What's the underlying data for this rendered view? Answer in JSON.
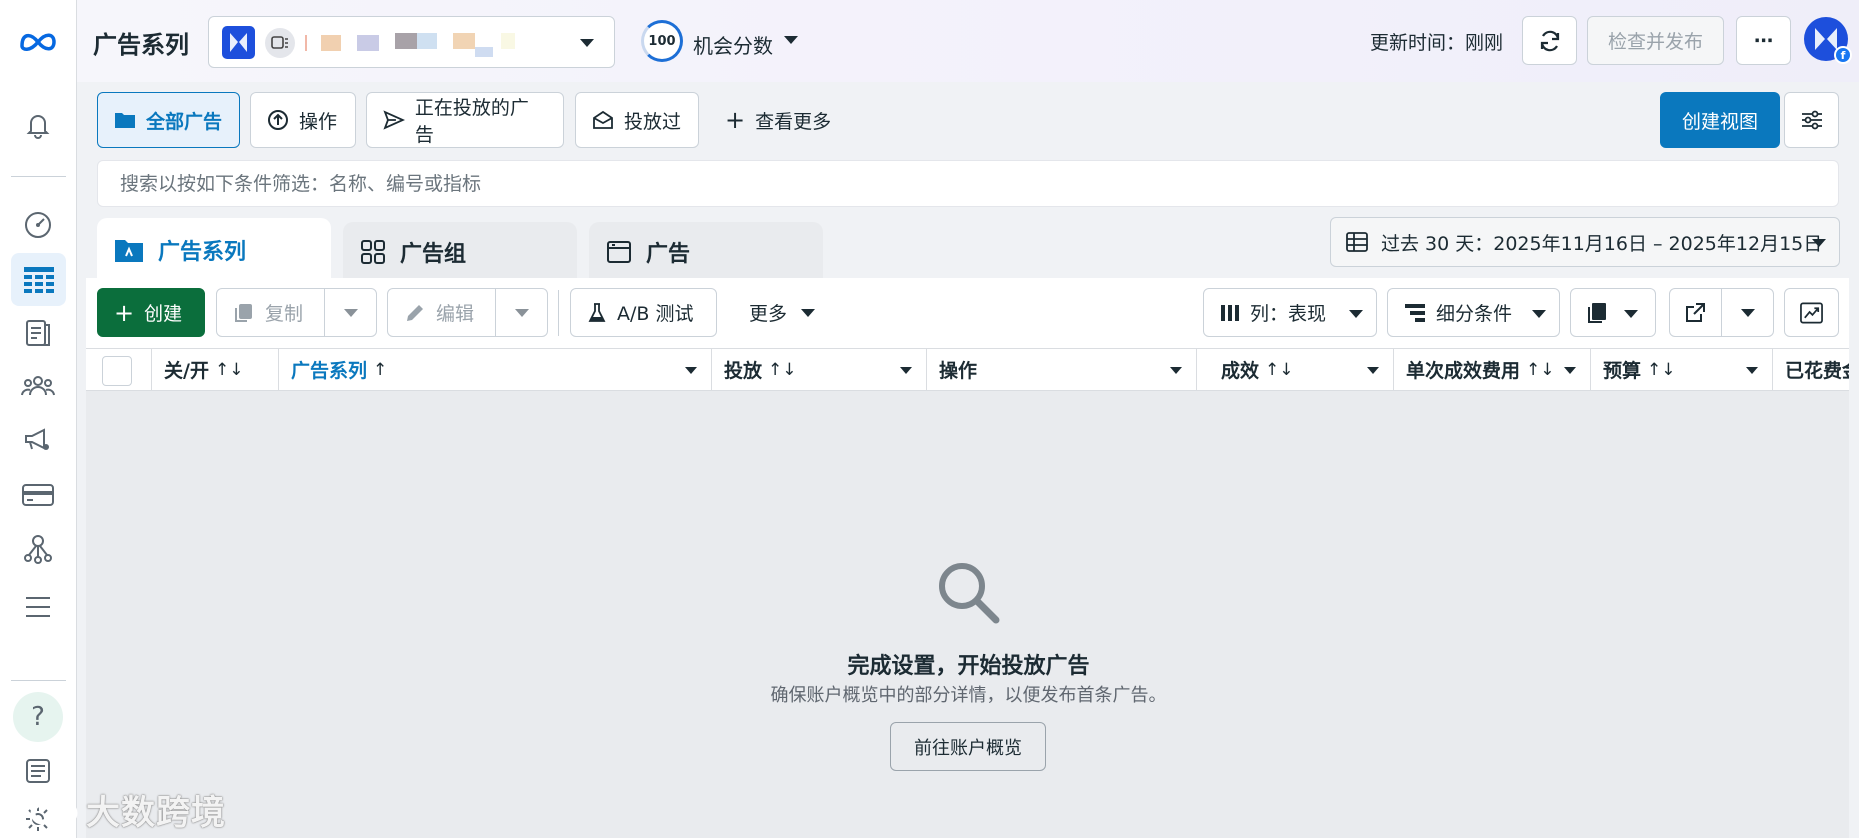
{
  "header": {
    "title": "广告系列",
    "score": "100",
    "score_label": "机会分数",
    "update_time": "更新时间：刚刚",
    "publish_button": "检查并发布",
    "more_icon": "⋯"
  },
  "filters": {
    "all_ads": "全部广告",
    "operations": "操作",
    "active_ads": "正在投放的广告",
    "delivered": "投放过",
    "see_more": "查看更多",
    "create_view": "创建视图"
  },
  "search": {
    "placeholder": "搜索以按如下条件筛选：名称、编号或指标"
  },
  "level_tabs": [
    {
      "label": "广告系列"
    },
    {
      "label": "广告组"
    },
    {
      "label": "广告"
    }
  ],
  "date_range": "过去 30 天：2025年11月16日 – 2025年12月15日",
  "toolbar": {
    "create": "创建",
    "duplicate": "复制",
    "edit": "编辑",
    "ab_test": "A/B 测试",
    "more": "更多",
    "columns": "列：表现",
    "breakdown": "细分条件"
  },
  "table": {
    "columns": [
      "关/开",
      "广告系列",
      "投放",
      "操作",
      "成效",
      "单次成效费用",
      "预算",
      "已花费金"
    ],
    "sort_both": "↑↓",
    "sort_up": "↑"
  },
  "empty_state": {
    "title": "完成设置，开始投放广告",
    "description": "确保账户概览中的部分详情，以便发布首条广告。",
    "button": "前往账户概览"
  },
  "watermark": "大数跨境",
  "colors": {
    "brand_blue": "#0a78be",
    "create_green": "#0b6e3c",
    "meta_blue": "#0668E1"
  }
}
